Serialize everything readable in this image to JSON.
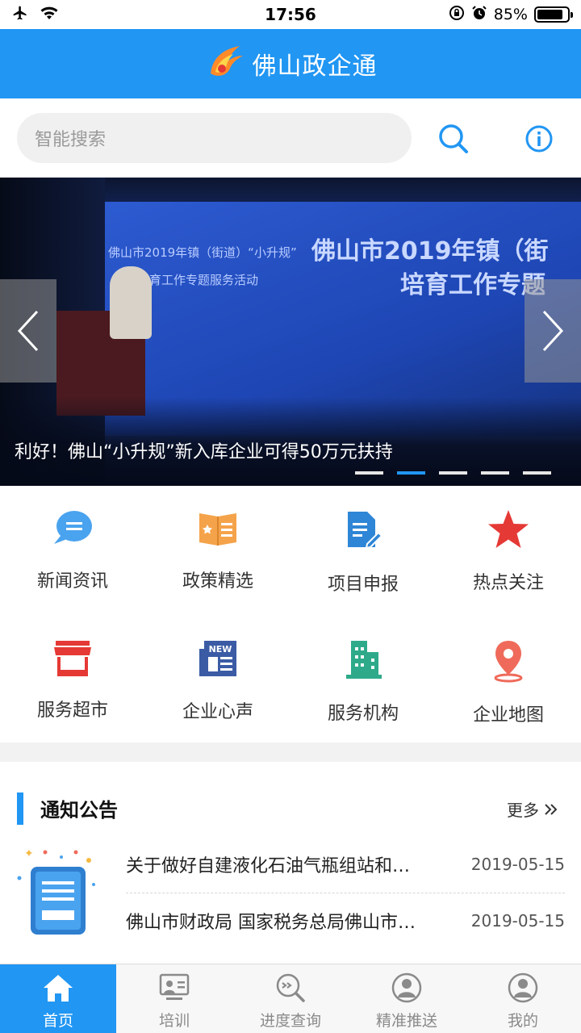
{
  "status_bar": {
    "time": "17:56",
    "battery": "85%",
    "battery_level": 0.85
  },
  "header": {
    "title": "佛山政企通"
  },
  "search": {
    "placeholder": "智能搜索"
  },
  "banner": {
    "caption": "利好！佛山“小升规”新入库企业可得50万元扶持",
    "photo_text_large_1": "佛山市2019年镇（街",
    "photo_text_large_2": "培育工作专题",
    "photo_text_small_1": "佛山市2019年镇（街道）“小升规”",
    "photo_text_small_2": "培育工作专题服务活动",
    "slide_count": 5,
    "active_slide": 2
  },
  "grid": [
    {
      "label": "新闻资讯",
      "icon": "news-chat-icon"
    },
    {
      "label": "政策精选",
      "icon": "policy-book-icon"
    },
    {
      "label": "项目申报",
      "icon": "document-edit-icon"
    },
    {
      "label": "热点关注",
      "icon": "star-icon"
    },
    {
      "label": "服务超市",
      "icon": "store-icon"
    },
    {
      "label": "企业心声",
      "icon": "newspaper-icon"
    },
    {
      "label": "服务机构",
      "icon": "building-icon"
    },
    {
      "label": "企业地图",
      "icon": "map-pin-icon"
    }
  ],
  "notices": {
    "title": "通知公告",
    "more": "更多",
    "items": [
      {
        "text": "关于做好自建液化石油气瓶组站和…",
        "date": "2019-05-15"
      },
      {
        "text": "佛山市财政局 国家税务总局佛山市…",
        "date": "2019-05-15"
      }
    ]
  },
  "tabs": [
    {
      "label": "首页",
      "icon": "home-icon",
      "active": true
    },
    {
      "label": "培训",
      "icon": "training-icon",
      "active": false
    },
    {
      "label": "进度查询",
      "icon": "progress-search-icon",
      "active": false
    },
    {
      "label": "精准推送",
      "icon": "user-push-icon",
      "active": false
    },
    {
      "label": "我的",
      "icon": "profile-icon",
      "active": false
    }
  ],
  "colors": {
    "primary": "#2196f3",
    "orange": "#f5a34a",
    "red": "#e53935",
    "green": "#2eaa8a"
  }
}
